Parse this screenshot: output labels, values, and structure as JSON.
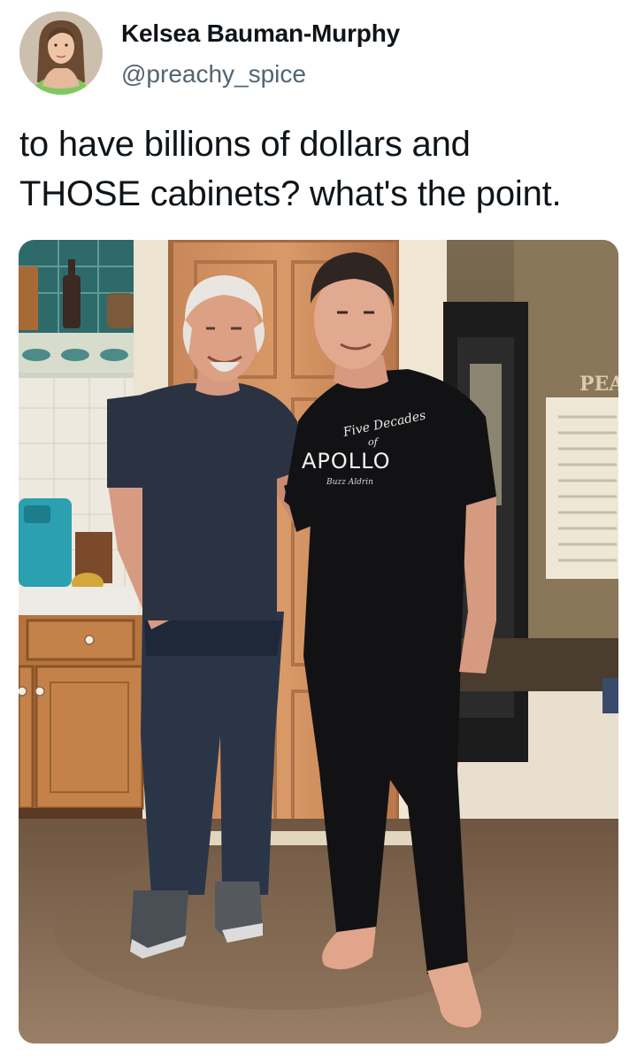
{
  "author": {
    "display_name": "Kelsea Bauman-Murphy",
    "handle": "@preachy_spice"
  },
  "tweet": {
    "text": "to have billions of dollars and\nTHOSE cabinets? what's the point."
  },
  "media": {
    "shirt_print": {
      "script_line_1": "Five Decades",
      "script_line_2": "of",
      "word": "APOLLO",
      "signature": "Buzz Aldrin"
    },
    "wall_sign": "PEA"
  },
  "colors": {
    "text_primary": "#0f1419",
    "text_secondary": "#536471",
    "background": "#ffffff"
  }
}
